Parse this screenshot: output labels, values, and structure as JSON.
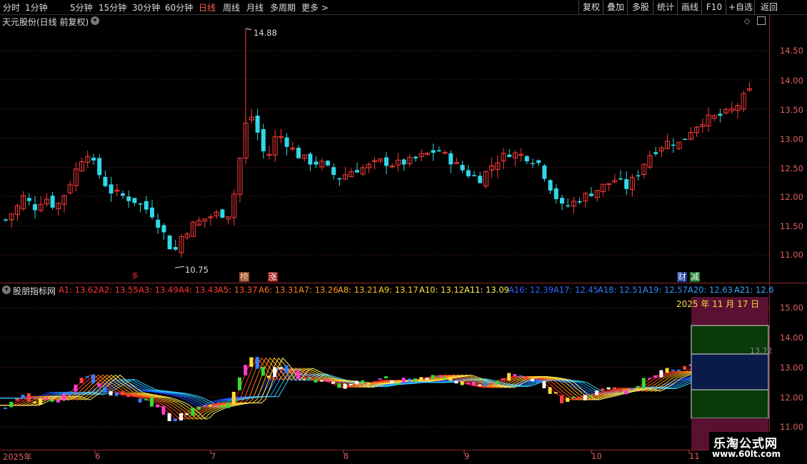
{
  "toolbar": {
    "periods": [
      "分时",
      "1分钟",
      "5分钟",
      "15分钟",
      "30分钟",
      "60分钟",
      "日线",
      "周线",
      "月线",
      "多周期",
      "更多"
    ],
    "active_period": "日线",
    "more_arrow": ">",
    "right_buttons": [
      "复权",
      "叠加",
      "多股",
      "统计",
      "画线",
      "F10",
      "+自选",
      "返回"
    ]
  },
  "main_panel": {
    "title": "天元股份(日线 前复权)",
    "y_ticks": [
      "14.50",
      "14.00",
      "13.50",
      "13.00",
      "12.50",
      "12.00",
      "11.50",
      "11.00"
    ],
    "high_label": "14.88",
    "low_label": "10.75",
    "markers": [
      {
        "text": "多",
        "color": "#e03030"
      },
      {
        "text": "榜",
        "color": "#ffb0a0"
      },
      {
        "text": "涨",
        "color": "#ffffff"
      },
      {
        "text": "财",
        "color": "#ffffff"
      },
      {
        "text": "减",
        "color": "#ffffff"
      }
    ]
  },
  "indicator_panel": {
    "name": "股朋指标网",
    "legend": [
      {
        "label": "A1: 13.62",
        "color": "#ff3030"
      },
      {
        "label": "A2: 13.55",
        "color": "#ff3030"
      },
      {
        "label": "A3: 13.49",
        "color": "#ff3030"
      },
      {
        "label": "A4: 13.43",
        "color": "#ff3030"
      },
      {
        "label": "A5: 13.37",
        "color": "#ff5020"
      },
      {
        "label": "A6: 13.31",
        "color": "#ff7020"
      },
      {
        "label": "A7: 13.26",
        "color": "#ff9020"
      },
      {
        "label": "A8: 13.21",
        "color": "#ffb020"
      },
      {
        "label": "A9: 13.17",
        "color": "#ffd020"
      },
      {
        "label": "A10: 13.12",
        "color": "#ffe040"
      },
      {
        "label": "A11: 13.09",
        "color": "#fff060"
      },
      {
        "label": "A16: 12.39",
        "color": "#3060ff"
      },
      {
        "label": "A17: 12.45",
        "color": "#3070ff"
      },
      {
        "label": "A18: 12.51",
        "color": "#3080ff"
      },
      {
        "label": "A19: 12.57",
        "color": "#3090ff"
      },
      {
        "label": "A20: 12.63",
        "color": "#30a0ff"
      },
      {
        "label": "A21: 12.6",
        "color": "#30b0ff"
      }
    ],
    "y_ticks": [
      "15.00",
      "14.00",
      "13.00",
      "12.00",
      "11.00"
    ],
    "date_box": "2025 年 11 月 17 日",
    "price_tag": "13.72"
  },
  "x_axis": [
    "2025年",
    "6",
    "7",
    "8",
    "9",
    "10",
    "11"
  ],
  "watermark": {
    "title": "乐淘公式网",
    "url": "www.60lt.com"
  },
  "colors": {
    "up": "#ff3b3b",
    "down": "#30d8e8",
    "axis": "#e06060",
    "grid": "#7a2424"
  }
}
